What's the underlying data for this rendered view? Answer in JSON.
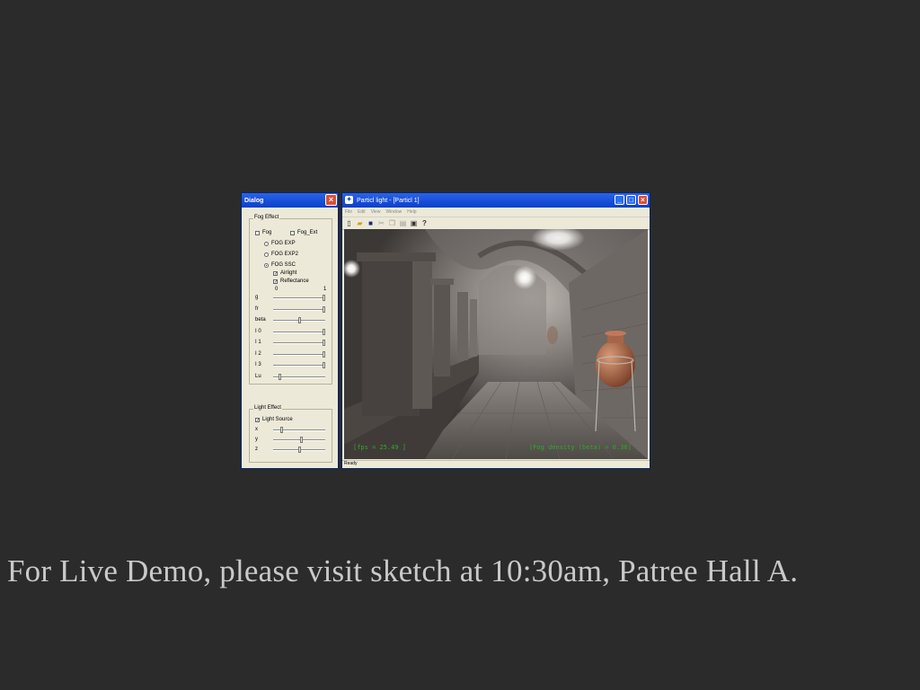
{
  "caption": "For Live Demo, please visit sketch at 10:30am, Patree Hall A.",
  "dialog": {
    "title": "Dialog",
    "fog_group": {
      "title": "Fog Effect",
      "fog_label": "Fog",
      "fog_ext_label": "Fog_Ext",
      "fog_exp": "FOG EXP",
      "fog_exp2": "FOG EXP2",
      "fog_ssc": "FOG SSC",
      "airlight": "Airlight",
      "reflectance": "Reflectance",
      "scale_min": "0",
      "scale_max": "1",
      "sliders": [
        {
          "label": "g",
          "value": 1.0
        },
        {
          "label": "fr",
          "value": 1.0
        },
        {
          "label": "beta",
          "value": 0.5
        },
        {
          "label": "I 0",
          "value": 1.0
        },
        {
          "label": "I 1",
          "value": 1.0
        },
        {
          "label": "I 2",
          "value": 1.0
        },
        {
          "label": "I 3",
          "value": 1.0
        },
        {
          "label": "Lu",
          "value": 0.1
        }
      ]
    },
    "light_group": {
      "title": "Light Effect",
      "light_source": "Light Source",
      "sliders": [
        {
          "label": "x",
          "value": 0.15
        },
        {
          "label": "y",
          "value": 0.55
        },
        {
          "label": "z",
          "value": 0.5
        }
      ]
    }
  },
  "app": {
    "title": "Particl light - [Particl 1]",
    "menu": [
      "File",
      "Edit",
      "View",
      "Window",
      "Help"
    ],
    "status": "Ready",
    "hud_left": "[fps = 25.49 ]",
    "hud_right": "[Fog density (beta) = 0.36]"
  },
  "colors": {
    "background": "#2b2b2b",
    "caption": "#c9c9c9",
    "titlebar": "#0a3fcc",
    "hud": "#2ea82e"
  }
}
